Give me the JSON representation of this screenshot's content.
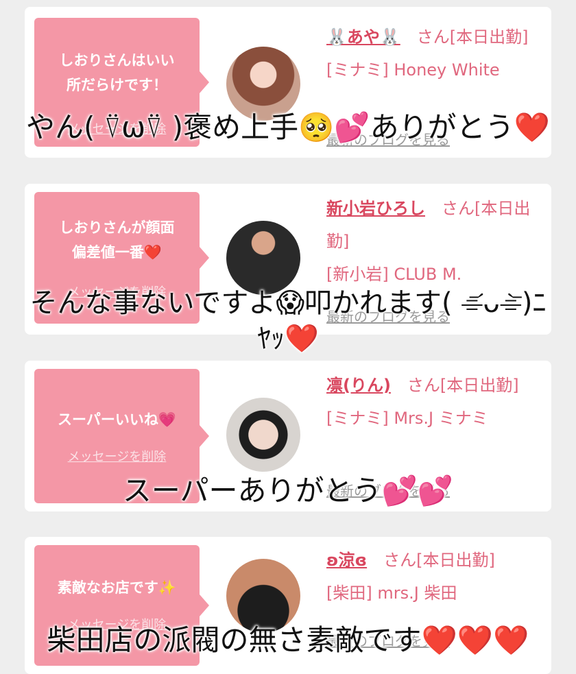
{
  "cards": [
    {
      "message": "しおりさんはいい\n所だらけです！",
      "delete_label": "メッセージを削除",
      "name": "🐰あや🐰",
      "suffix": "　さん[本日出勤]",
      "shop": "[ミナミ] Honey White",
      "blog_link": "最新のブログを見る",
      "caption": "やん( ⍢ω⍢ )褒め上手🥺💕ありがとう❤️"
    },
    {
      "message": "しおりさんが顔面\n偏差値一番❤️",
      "delete_label": "メッセージを削除",
      "name": "新小岩ひろし",
      "suffix": "　さん[本日出勤]",
      "shop": "[新小岩] CLUB M.",
      "blog_link": "最新のブログを見る",
      "caption": "そんな事ないですよ😱叩かれます( ⌯᷄ᴗ⌯᷅)ﾆ\nﾔｯ❤️"
    },
    {
      "message": "スーパーいいね💗",
      "delete_label": "メッセージを削除",
      "name": "凛(りん)",
      "suffix": "　さん[本日出勤]",
      "shop": "[ミナミ] Mrs.J ミナミ",
      "blog_link": "最新のブログを見る",
      "caption": "スーパーありがとう💕💕"
    },
    {
      "message": "素敵なお店です✨",
      "delete_label": "メッセージを削除",
      "name": "ʚ涼ɞ",
      "suffix": "　さん[本日出勤]",
      "shop": "[柴田] mrs.J 柴田",
      "blog_link": "最新のブログを見る",
      "caption": "柴田店の派閥の無さ素敵です❤️❤️❤️"
    }
  ]
}
